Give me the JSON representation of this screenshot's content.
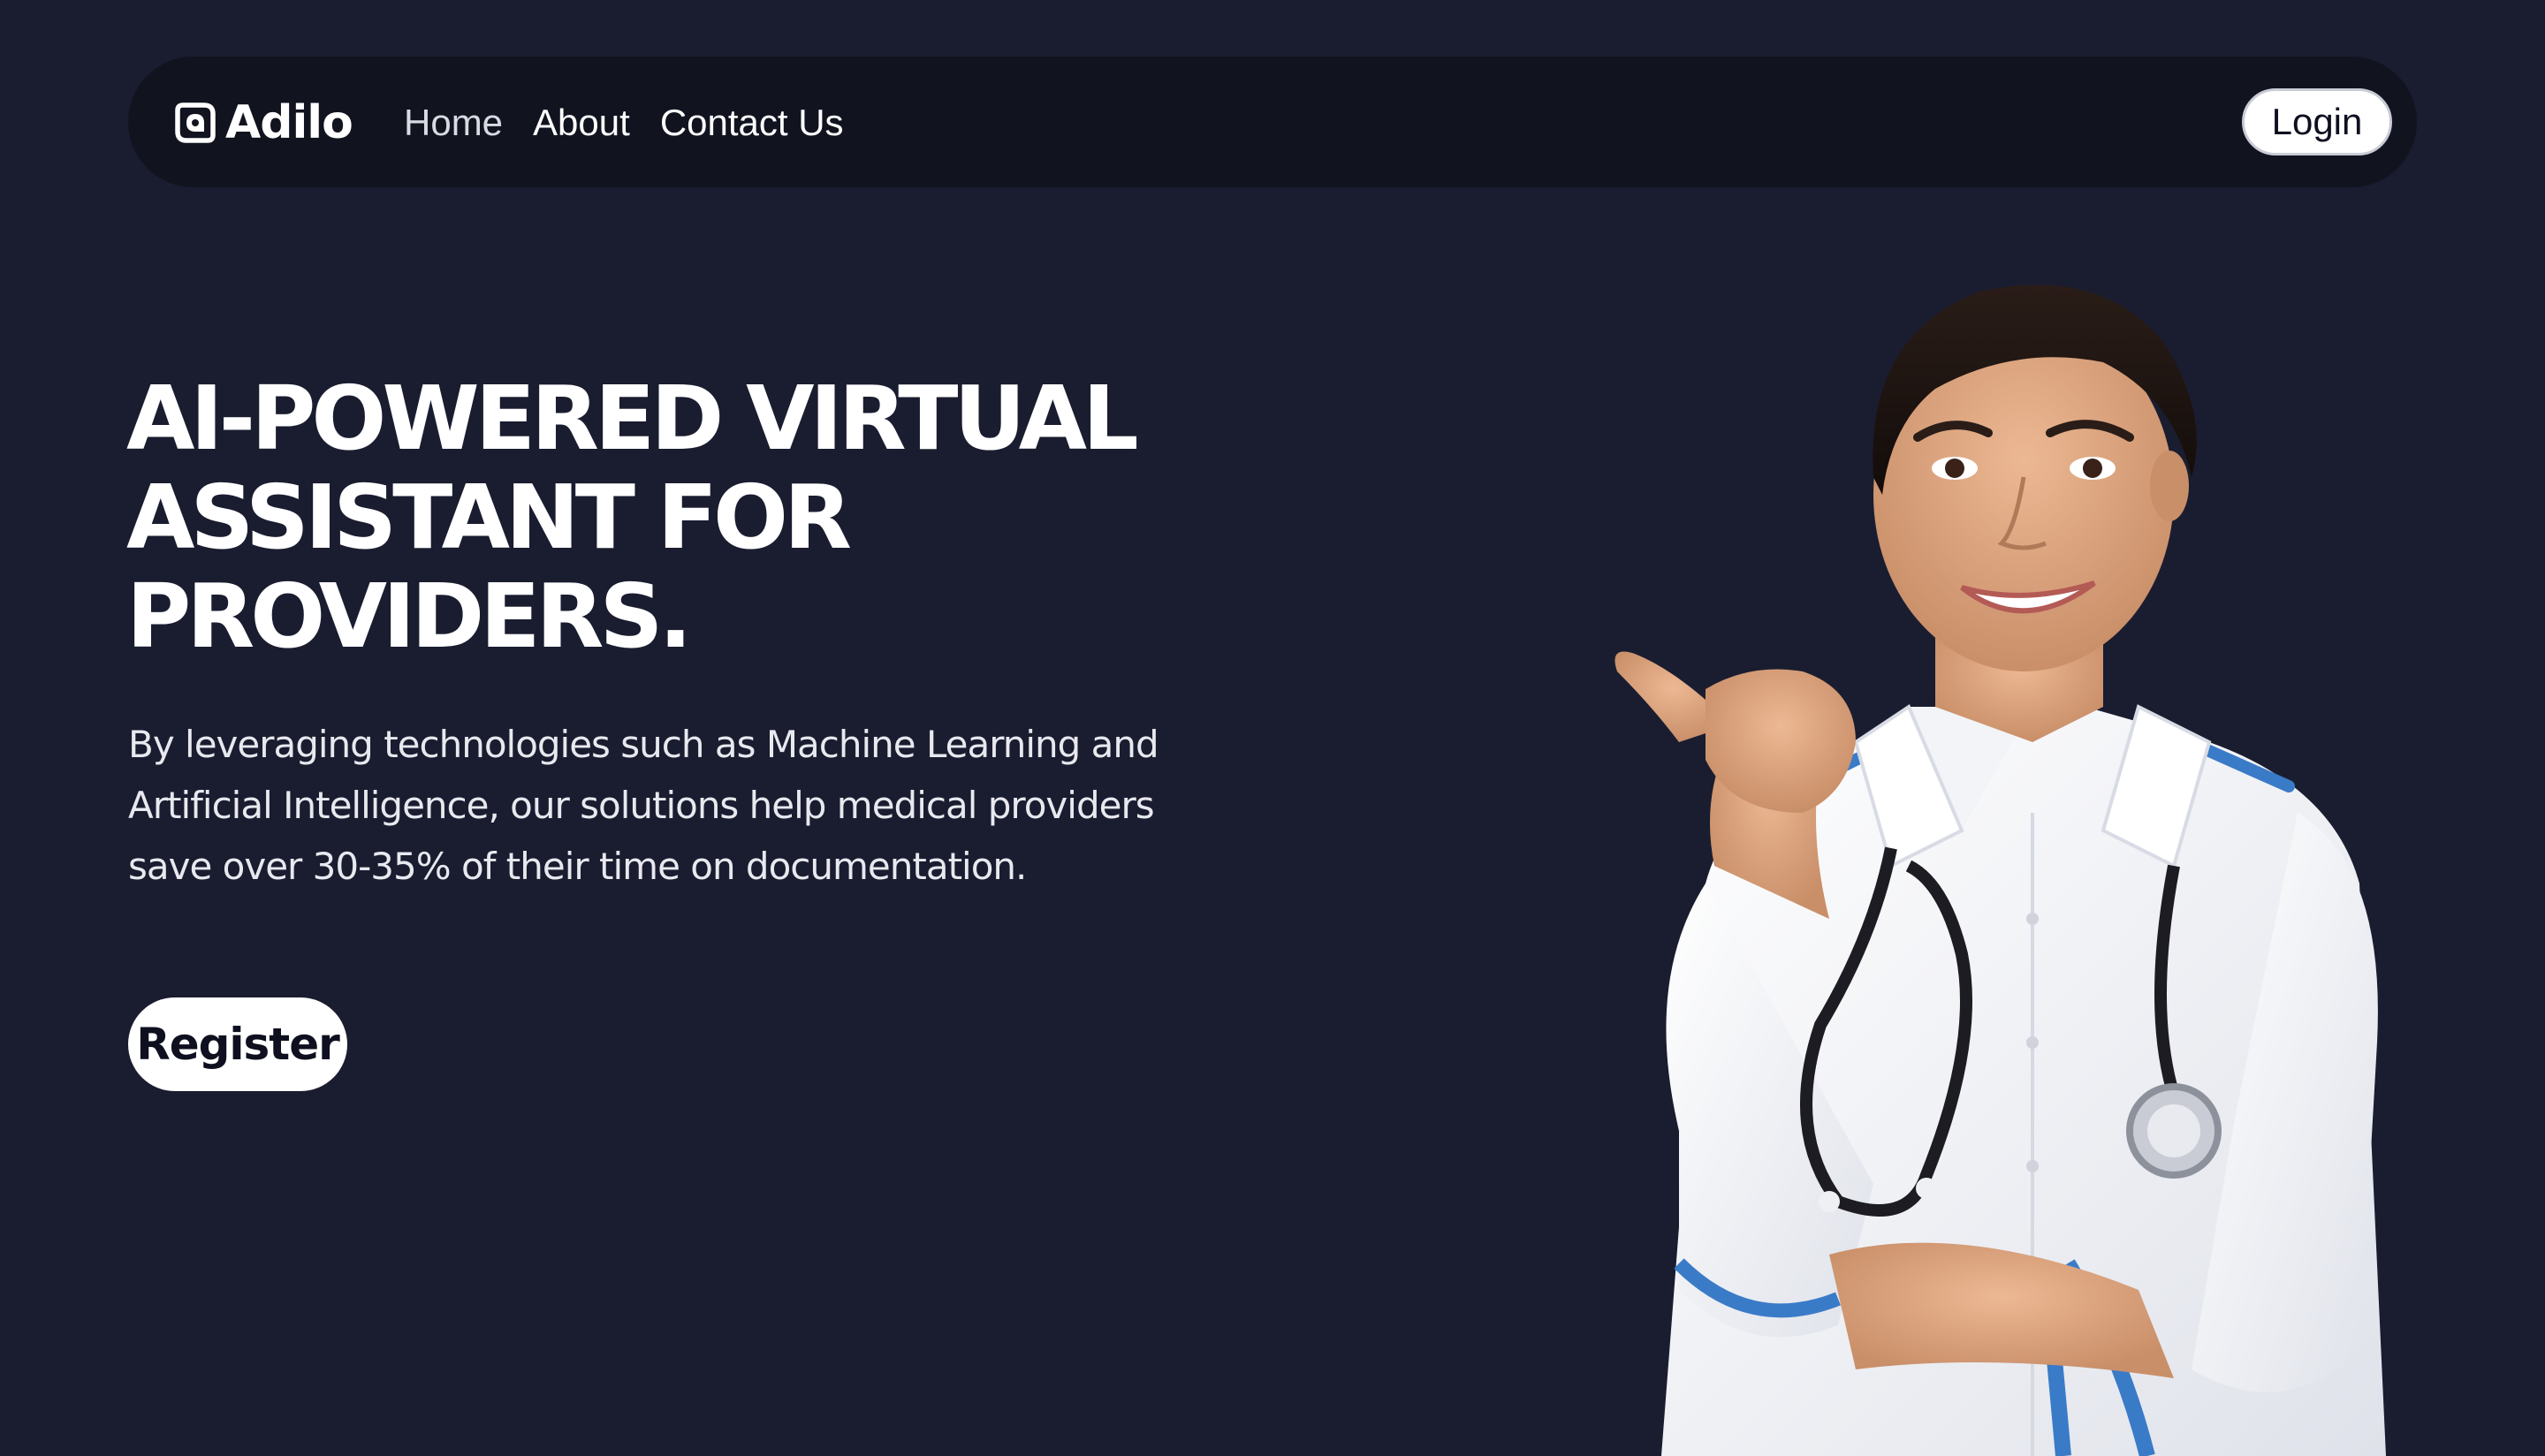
{
  "brand": {
    "name": "Adilo",
    "icon": "rounded-square-logo-icon"
  },
  "nav": {
    "items": [
      {
        "label": "Home"
      },
      {
        "label": "About"
      },
      {
        "label": "Contact Us"
      }
    ],
    "login_label": "Login"
  },
  "hero": {
    "title": "AI-POWERED VIRTUAL ASSISTANT FOR PROVIDERS.",
    "description": "By leveraging technologies such as Machine Learning and Artificial Intelligence, our solutions help medical providers save over 30-35% of their time on documentation.",
    "register_label": "Register",
    "image": "smiling-nurse-thumbs-point-illustration"
  },
  "colors": {
    "background": "#1a1d30",
    "navbar": "#11131f",
    "text": "#ffffff",
    "button": "#ffffff",
    "button_text": "#0e1020",
    "accent_blue": "#3a7bc8"
  }
}
